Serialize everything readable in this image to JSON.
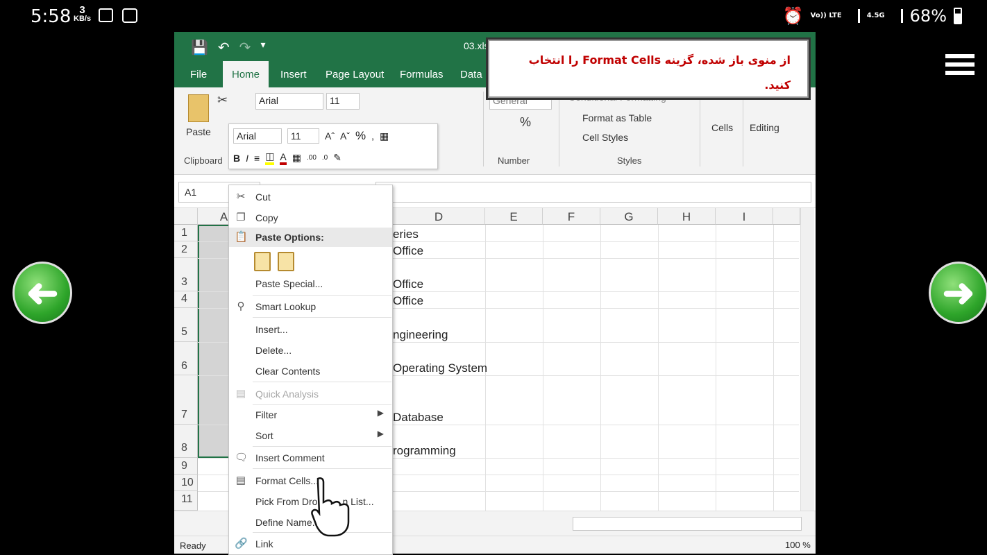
{
  "status_bar": {
    "time": "5:58",
    "speed_value": "3",
    "speed_unit": "KB/s",
    "volte": "Vo)) LTE",
    "network": "4.5G",
    "battery": "68%"
  },
  "excel": {
    "file_name": "03.xls",
    "tabs": [
      "File",
      "Home",
      "Insert",
      "Page Layout",
      "Formulas",
      "Data"
    ],
    "active_tab": "Home",
    "ribbon": {
      "paste_label": "Paste",
      "clipboard_label": "Clipboard",
      "font_name": "Arial",
      "font_size": "11",
      "number_format": "General",
      "number_label": "Number",
      "percent": "%",
      "conditional_formatting": "Conditional Formatting",
      "format_as_table": "Format as Table",
      "cell_styles": "Cell Styles",
      "styles_label": "Styles",
      "cells_label": "Cells",
      "editing_label": "Editing"
    },
    "name_box": "A1",
    "columns": [
      "A",
      "D",
      "E",
      "F",
      "G",
      "H",
      "I"
    ],
    "rows": [
      "1",
      "2",
      "3",
      "4",
      "5",
      "6",
      "7",
      "8",
      "9",
      "10",
      "11"
    ],
    "column_d_values": [
      "eries",
      "Office",
      "Office",
      "Office",
      "ngineering",
      "Operating System",
      "Database",
      "rogramming"
    ],
    "status_ready": "Ready",
    "zoom": "100 %"
  },
  "mini_toolbar": {
    "font_name": "Arial",
    "font_size": "11",
    "percent": "%",
    "bold": "B",
    "italic": "I"
  },
  "context_menu": {
    "cut": "Cut",
    "copy": "Copy",
    "paste_options": "Paste Options:",
    "paste_special": "Paste Special...",
    "smart_lookup": "Smart Lookup",
    "insert": "Insert...",
    "delete": "Delete...",
    "clear_contents": "Clear Contents",
    "quick_analysis": "Quick Analysis",
    "filter": "Filter",
    "sort": "Sort",
    "insert_comment": "Insert Comment",
    "format_cells": "Format Cells...",
    "pick_from_list": "Pick From Dro",
    "pick_from_list_tail": "n List...",
    "define_name": "Define Name...",
    "link": "Link"
  },
  "callout": {
    "line1_prefix": "از منوی باز شده، گزینه ",
    "keyword": "Format Cells",
    "line1_suffix": " را انتخاب",
    "line2": "کنید."
  },
  "colors": {
    "excel_green": "#217346",
    "callout_text": "#c00000",
    "nav_green": "#2ea52a"
  }
}
